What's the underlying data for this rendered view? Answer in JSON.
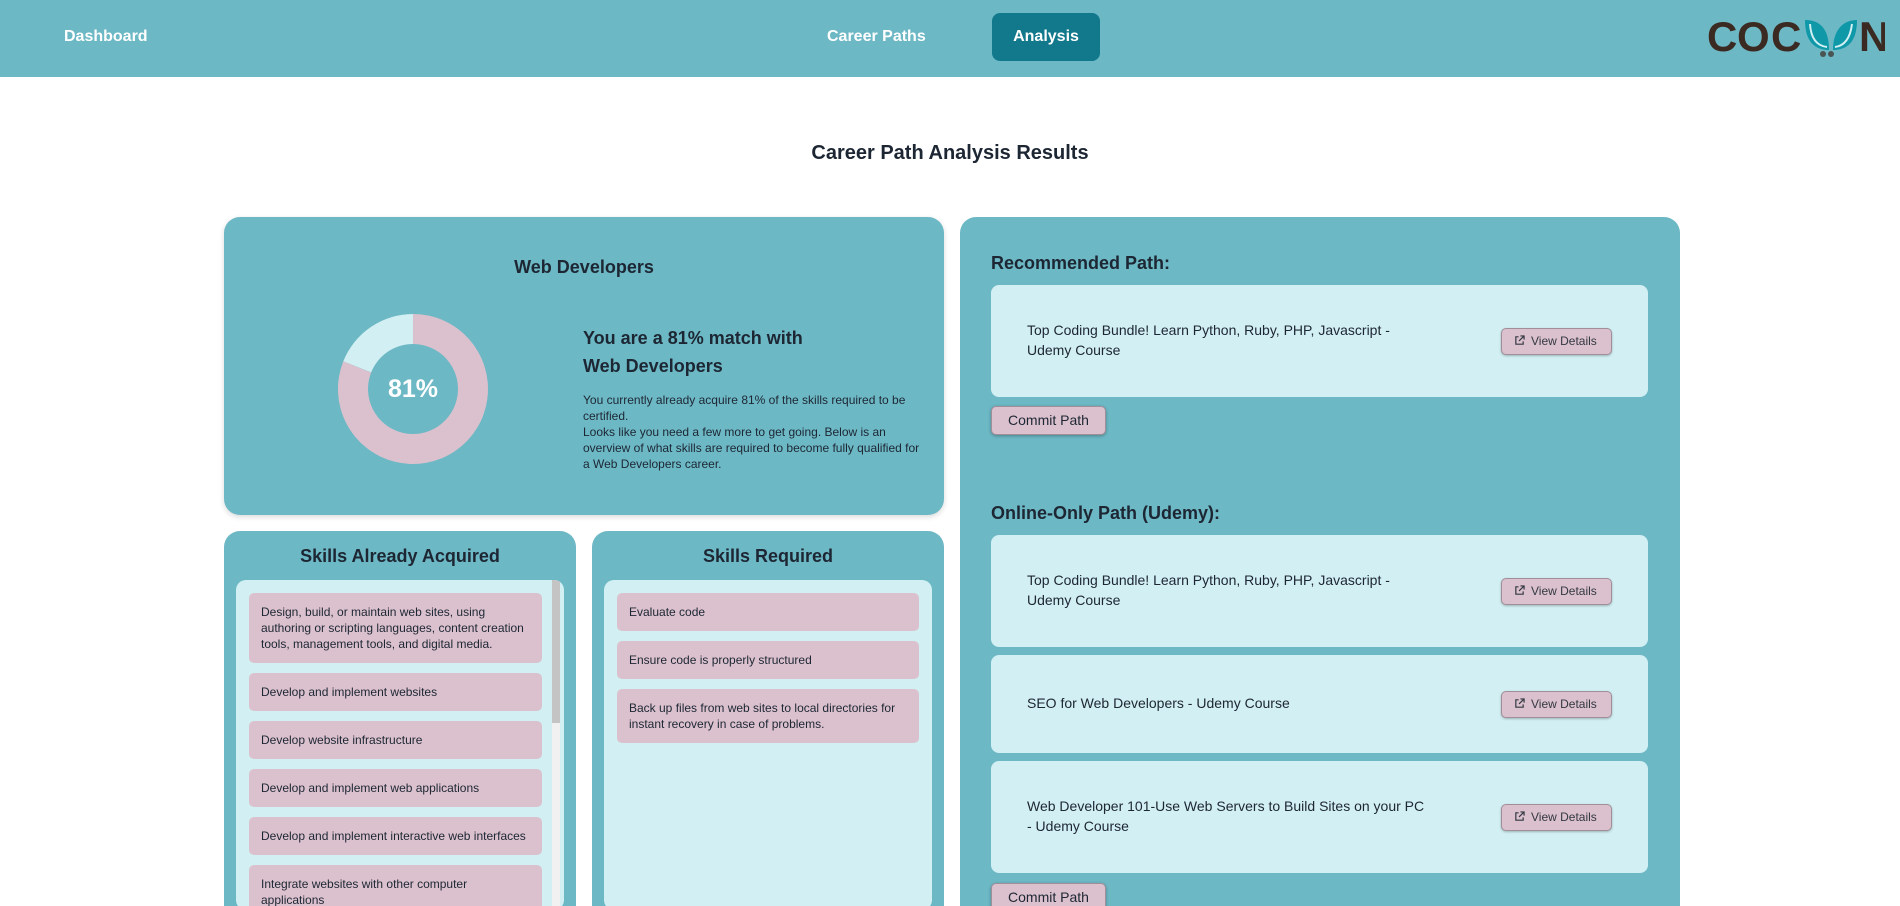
{
  "nav": {
    "dashboard": "Dashboard",
    "career_paths": "Career Paths",
    "analysis": "Analysis",
    "logo_text": "COCOON"
  },
  "page_title": "Career Path Analysis Results",
  "match": {
    "career": "Web Developers",
    "percent": 81,
    "percent_label": "81%",
    "heading": "You are a 81% match with Web Developers",
    "description_line1": "You currently already acquire 81% of the skills required to be certified.",
    "description_line2": "Looks like you need a few more to get going. Below is an overview of what skills are required to become fully qualified for a Web Developers career."
  },
  "skills_acquired": {
    "title": "Skills Already Acquired",
    "items": [
      "Design, build, or maintain web sites, using authoring or scripting languages, content creation tools, management tools, and digital media.",
      "Develop and implement websites",
      "Develop website infrastructure",
      "Develop and implement web applications",
      "Develop and implement interactive web interfaces",
      "Integrate websites with other computer applications"
    ]
  },
  "skills_required": {
    "title": "Skills Required",
    "items": [
      "Evaluate code",
      "Ensure code is properly structured",
      "Back up files from web sites to local directories for instant recovery in case of problems."
    ]
  },
  "recommended_path": {
    "title": "Recommended Path:",
    "courses": [
      "Top Coding Bundle! Learn Python, Ruby, PHP, Javascript - Udemy Course"
    ],
    "commit_label": "Commit Path"
  },
  "online_path": {
    "title": "Online-Only Path (Udemy):",
    "courses": [
      "Top Coding Bundle! Learn Python, Ruby, PHP, Javascript - Udemy Course",
      "SEO for Web Developers - Udemy Course",
      "Web Developer 101-Use Web Servers to Build Sites on your PC - Udemy Course"
    ],
    "commit_label": "Commit Path"
  },
  "view_details_label": "View Details",
  "colors": {
    "nav_bg": "#6db8c5",
    "active_tab": "#12788c",
    "card_bg": "#6db8c5",
    "inner_bg": "#d2eff3",
    "pink": "#dbc1ce",
    "logo_dark": "#3b2a22",
    "logo_teal": "#0e98a8"
  }
}
